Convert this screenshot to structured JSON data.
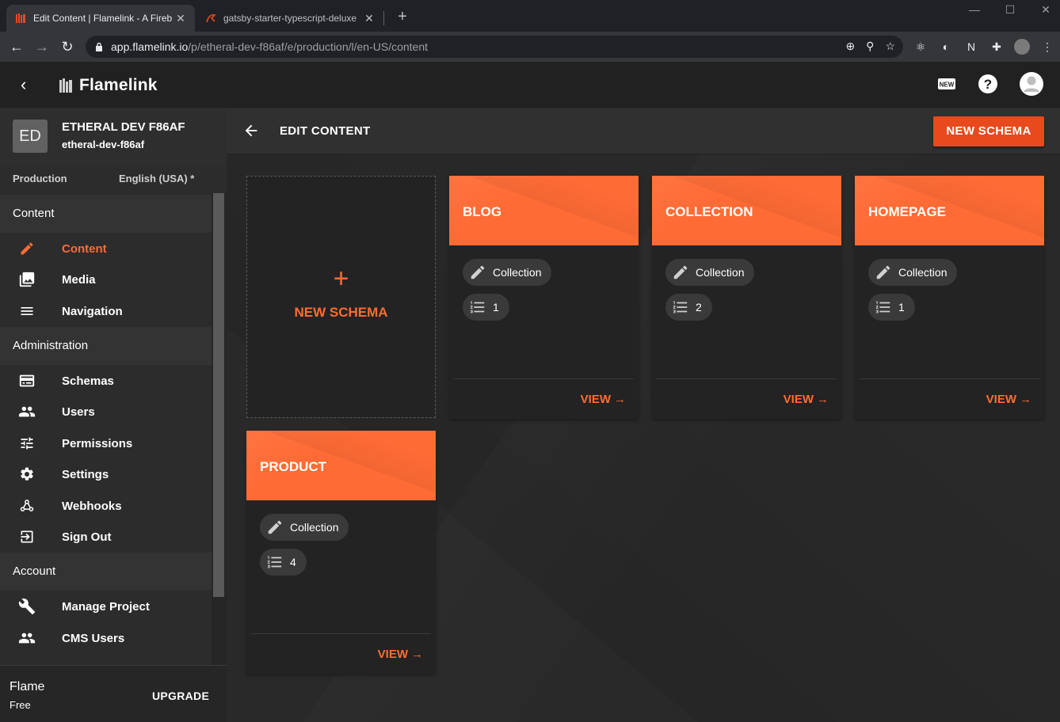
{
  "browser": {
    "tabs": [
      {
        "title": "Edit Content | Flamelink - A Fireb",
        "active": true
      },
      {
        "title": "gatsby-starter-typescript-deluxe",
        "active": false
      }
    ],
    "url_host": "app.flamelink.io",
    "url_path": "/p/etheral-dev-f86af/e/production/l/en-US/content"
  },
  "app": {
    "brand": "Flamelink"
  },
  "sidebar": {
    "project_initials": "ED",
    "project_name": "ETHERAL DEV F86AF",
    "project_id": "etheral-dev-f86af",
    "environment": "Production",
    "locale": "English (USA) *",
    "sections": [
      {
        "title": "Content",
        "items": [
          {
            "label": "Content",
            "icon": "pencil-icon",
            "active": true
          },
          {
            "label": "Media",
            "icon": "media-icon"
          },
          {
            "label": "Navigation",
            "icon": "menu-icon"
          }
        ]
      },
      {
        "title": "Administration",
        "items": [
          {
            "label": "Schemas",
            "icon": "schema-icon"
          },
          {
            "label": "Users",
            "icon": "users-icon"
          },
          {
            "label": "Permissions",
            "icon": "tune-icon"
          },
          {
            "label": "Settings",
            "icon": "gear-icon"
          },
          {
            "label": "Webhooks",
            "icon": "webhook-icon"
          },
          {
            "label": "Sign Out",
            "icon": "sign-out-icon"
          }
        ]
      },
      {
        "title": "Account",
        "items": [
          {
            "label": "Manage Project",
            "icon": "wrench-icon"
          },
          {
            "label": "CMS Users",
            "icon": "users-icon"
          }
        ]
      }
    ],
    "plan_name": "Flame",
    "plan_tier": "Free",
    "upgrade_label": "UPGRADE"
  },
  "main": {
    "title": "EDIT CONTENT",
    "new_schema_button": "NEW SCHEMA",
    "new_schema_card_label": "NEW SCHEMA",
    "view_label": "VIEW",
    "schemas": [
      {
        "name": "BLOG",
        "type": "Collection",
        "count": "1"
      },
      {
        "name": "COLLECTION",
        "type": "Collection",
        "count": "2"
      },
      {
        "name": "HOMEPAGE",
        "type": "Collection",
        "count": "1"
      },
      {
        "name": "PRODUCT",
        "type": "Collection",
        "count": "4"
      }
    ]
  },
  "colors": {
    "accent": "#ff6b35",
    "button": "#e8491d"
  }
}
